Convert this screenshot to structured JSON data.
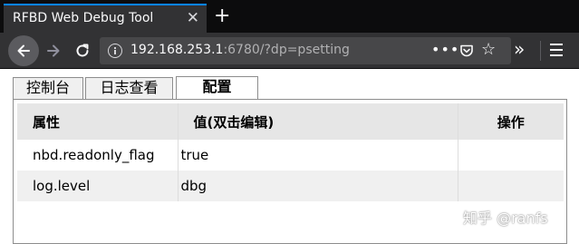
{
  "browser": {
    "tab_title": "RFBD Web Debug Tool",
    "tab_close": "✕",
    "new_tab": "+",
    "url_host": "192.168.253.1",
    "url_rest": ":6780/?dp=psetting",
    "url_actions": "•••",
    "star": "☆",
    "overflow": "»",
    "icons": [
      "back-arrow-icon",
      "forward-arrow-icon",
      "reload-icon",
      "info-icon",
      "pocket-icon",
      "star-icon",
      "overflow-icon",
      "hamburger-menu-icon"
    ],
    "accent_color": "#0a84ff"
  },
  "page_tabs": [
    {
      "label": "控制台",
      "active": false
    },
    {
      "label": "日志查看",
      "active": false
    },
    {
      "label": "配置",
      "active": true
    }
  ],
  "table": {
    "headers": [
      "属性",
      "值(双击编辑)",
      "操作"
    ],
    "rows": [
      {
        "key": "nbd.readonly_flag",
        "value": "true",
        "op": ""
      },
      {
        "key": "log.level",
        "value": "dbg",
        "op": ""
      }
    ]
  },
  "watermark": "知乎 @ranfs"
}
